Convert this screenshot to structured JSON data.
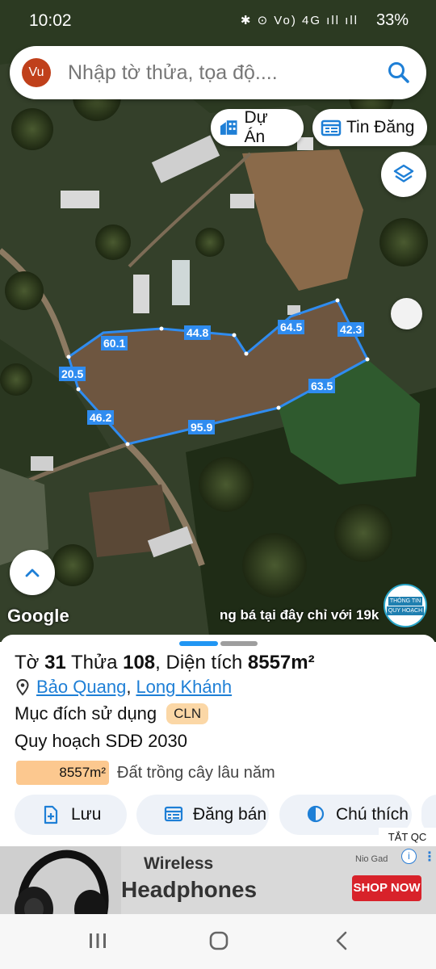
{
  "status_bar": {
    "time": "10:02",
    "indicators": "✱ ⊙ Vo) 4G ıll ıll",
    "battery": "33%"
  },
  "search": {
    "avatar_initials": "Vu",
    "placeholder": "Nhập tờ thửa, tọa độ...."
  },
  "chips": {
    "du_an": "Dự Án",
    "tin_dang": "Tin Đăng"
  },
  "map": {
    "attribution": "Google",
    "ad_marquee": "ng bá tại đây chỉ với 19k",
    "planning_logo_line1": "THÔNG TIN",
    "planning_logo_line2": "QUY HOẠCH",
    "parcel_outline_color": "#2f8cf0",
    "edge_labels": [
      "60.1",
      "44.8",
      "64.5",
      "42.3",
      "63.5",
      "95.9",
      "46.2",
      "20.5"
    ]
  },
  "parcel": {
    "to_label": "Tờ",
    "to_value": "31",
    "thua_label": "Thửa",
    "thua_value": "108",
    "area_label": ", Diện tích",
    "area_value": "8557m²",
    "ward": "Bảo Quang",
    "city": "Long Khánh",
    "purpose_label": "Mục đích sử dụng",
    "purpose_code": "CLN",
    "plan_label": "Quy hoạch SDĐ 2030",
    "plan_area": "8557m²",
    "plan_land_type": "Đất trồng cây lâu năm"
  },
  "actions": {
    "save": "Lưu",
    "post": "Đăng bán",
    "legend": "Chú thích"
  },
  "ad": {
    "close_label": "TẮT QC",
    "brand": "Nio Gad",
    "headline1": "Wireless",
    "headline2": "Headphones",
    "cta": "SHOP NOW",
    "info_icon": "i"
  }
}
